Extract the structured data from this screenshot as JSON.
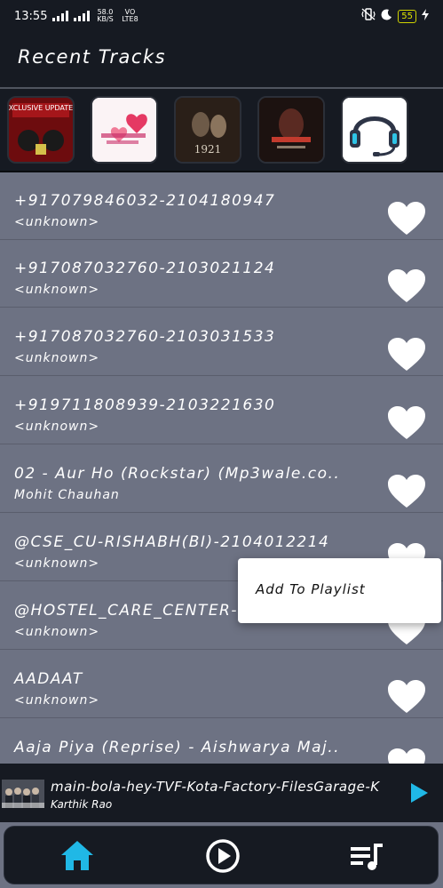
{
  "status_bar": {
    "time": "13:55",
    "net_speed": "58.0 KB/S",
    "carrier": "VO LTE8",
    "battery": "55"
  },
  "app_bar": {
    "title": "Recent Tracks"
  },
  "recent_thumbnails": [
    {
      "icon": "album-art-exclusive-updates",
      "text": "EXCLUSIVE UPDATES"
    },
    {
      "icon": "album-art-pink-hearts"
    },
    {
      "icon": "album-art-1921",
      "text": "1921"
    },
    {
      "icon": "album-art-dark-poster"
    },
    {
      "icon": "headset-icon"
    }
  ],
  "tracks": [
    {
      "title": "+917079846032-2104180947",
      "artist": "<unknown>"
    },
    {
      "title": "+917087032760-2103021124",
      "artist": "<unknown>"
    },
    {
      "title": "+917087032760-2103031533",
      "artist": "<unknown>"
    },
    {
      "title": "+919711808939-2103221630",
      "artist": "<unknown>"
    },
    {
      "title": "02 - Aur Ho (Rockstar) (Mp3wale.co..",
      "artist": "Mohit Chauhan"
    },
    {
      "title": "@CSE_CU-RISHABH(BI)-2104012214",
      "artist": "<unknown>"
    },
    {
      "title": "@HOSTEL_CARE_CENTER-",
      "artist": "<unknown>"
    },
    {
      "title": "AADAAT",
      "artist": "<unknown>"
    },
    {
      "title": "Aaja Piya (Reprise) - Aishwarya Maj..",
      "artist": ""
    }
  ],
  "context_menu": {
    "items": [
      "Add To Playlist"
    ]
  },
  "mini_player": {
    "title": "main-bola-hey-TVF-Kota-Factory-FilesGarage-K",
    "artist": "Karthik Rao"
  },
  "bottom_nav": [
    {
      "icon": "home-icon"
    },
    {
      "icon": "play-circle-icon"
    },
    {
      "icon": "playlist-icon"
    }
  ],
  "colors": {
    "accent": "#20b8e6",
    "background": "#6d7283",
    "bar": "#161a22",
    "popup": "#ffffff"
  }
}
